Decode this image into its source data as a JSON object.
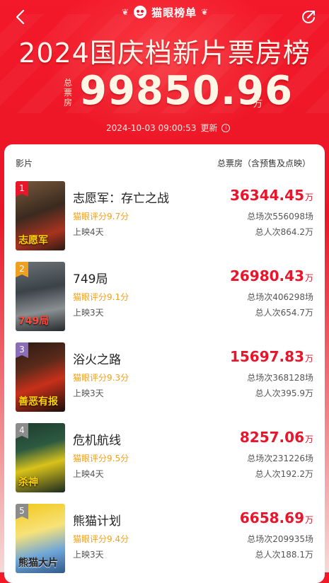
{
  "header": {
    "brand": "猫眼榜单",
    "title": "2024国庆档新片票房榜",
    "total_label": "总票房",
    "total_value": "99850.96",
    "total_unit": "万",
    "updated_time": "2024-10-03  09:00:53",
    "updated_label": "更新"
  },
  "table": {
    "col_film": "影片",
    "col_total": "总票房（含预售及点映）"
  },
  "colors": {
    "brand_red": "#e8152b",
    "score_orange": "#f0a020",
    "rank_colors": [
      "#e8152b",
      "#f0a020",
      "#8a6fb8",
      "#8c8c8c",
      "#8c8c8c"
    ]
  },
  "films": [
    {
      "rank": "1",
      "name": "志愿军：存亡之战",
      "score": "猫眼评分9.7分",
      "days": "上映4天",
      "box": "36344.45",
      "unit": "万",
      "sessions": "总场次556098场",
      "viewers": "总人次864.2万",
      "poster_text": "志愿军"
    },
    {
      "rank": "2",
      "name": "749局",
      "score": "猫眼评分9.1分",
      "days": "上映3天",
      "box": "26980.43",
      "unit": "万",
      "sessions": "总场次406298场",
      "viewers": "总人次654.7万",
      "poster_text": "749局"
    },
    {
      "rank": "3",
      "name": "浴火之路",
      "score": "猫眼评分9.3分",
      "days": "上映3天",
      "box": "15697.83",
      "unit": "万",
      "sessions": "总场次368128场",
      "viewers": "总人次395.9万",
      "poster_text": "善恶有报"
    },
    {
      "rank": "4",
      "name": "危机航线",
      "score": "猫眼评分9.5分",
      "days": "上映4天",
      "box": "8257.06",
      "unit": "万",
      "sessions": "总场次231226场",
      "viewers": "总人次192.2万",
      "poster_text": "杀神"
    },
    {
      "rank": "5",
      "name": "熊猫计划",
      "score": "猫眼评分9.4分",
      "days": "上映3天",
      "box": "6658.69",
      "unit": "万",
      "sessions": "总场次209935场",
      "viewers": "总人次188.1万",
      "poster_text": "熊猫大片"
    }
  ]
}
